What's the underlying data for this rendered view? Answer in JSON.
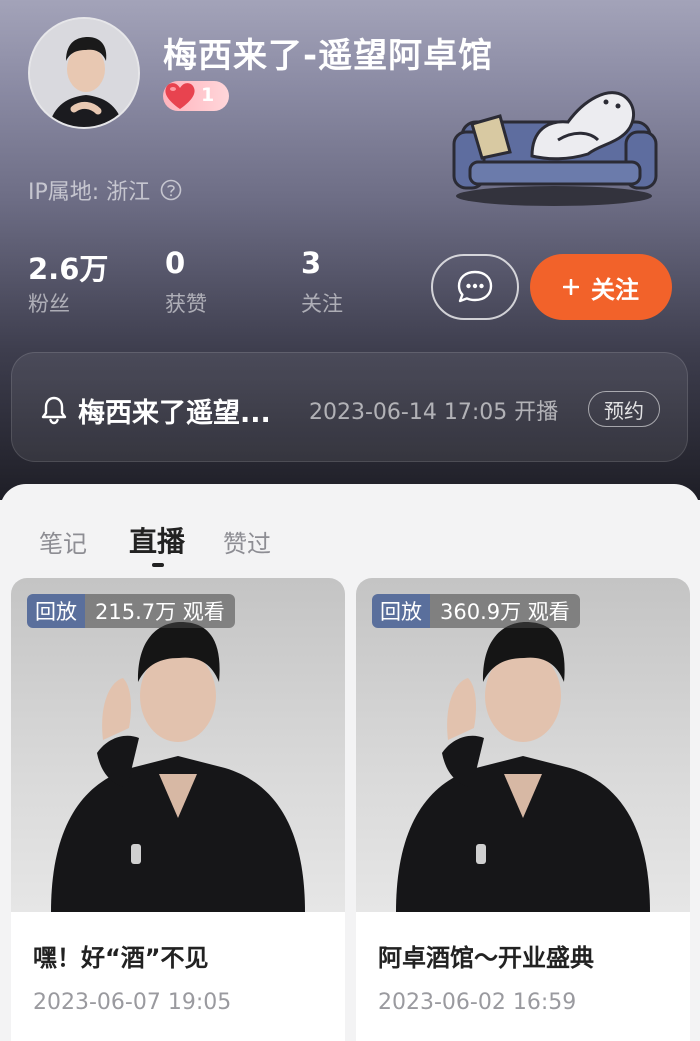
{
  "profile": {
    "username": "梅西来了-遥望阿卓馆",
    "badge_count": "1",
    "ip_location": "IP属地: 浙江"
  },
  "stats": [
    {
      "value": "2.6万",
      "label": "粉丝"
    },
    {
      "value": "0",
      "label": "获赞"
    },
    {
      "value": "3",
      "label": "关注"
    }
  ],
  "actions": {
    "message_icon": "chat-bubble-icon",
    "follow_label": "关注",
    "follow_icon": "plus-icon"
  },
  "live_notice": {
    "title": "梅西来了遥望...",
    "time": "2023-06-14 17:05 开播",
    "reserve_label": "预约"
  },
  "tabs": [
    {
      "label": "笔记",
      "active": false
    },
    {
      "label": "直播",
      "active": true
    },
    {
      "label": "赞过",
      "active": false
    }
  ],
  "cards": [
    {
      "tag": "回放",
      "views": "215.7万 观看",
      "title": "嘿！好“酒”不见",
      "date": "2023-06-07 19:05"
    },
    {
      "tag": "回放",
      "views": "360.9万 观看",
      "title": "阿卓酒馆～开业盛典",
      "date": "2023-06-02 16:59"
    }
  ],
  "colors": {
    "accent": "#f2622a",
    "tag_type": "#5a6f9c",
    "badge_heart": "#e8434f"
  }
}
